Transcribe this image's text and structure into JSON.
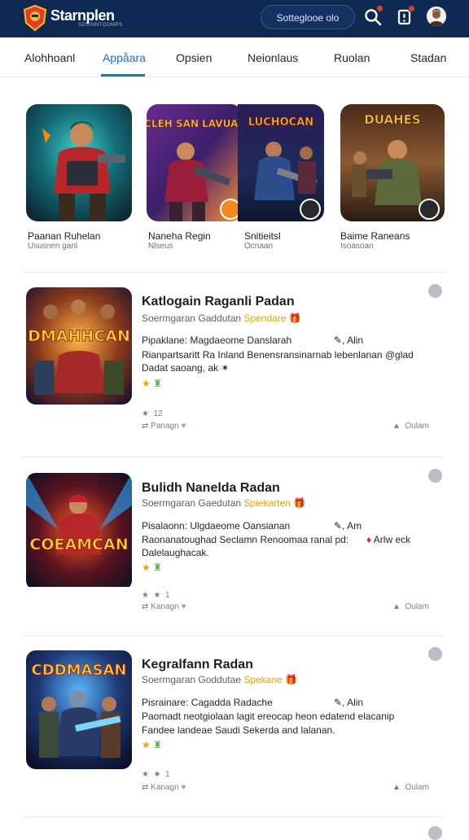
{
  "header": {
    "brand": "Starnplen",
    "brand_sub": "SDSINNTOOMPS",
    "search_label": "Sotteglooe olo",
    "icons": [
      "search-icon",
      "notification-icon",
      "avatar"
    ],
    "colors": {
      "bar": "#0f2a52",
      "accent": "#1a73c7",
      "badge": "#e53935"
    }
  },
  "tabs": [
    {
      "label": "Alohhoanl"
    },
    {
      "label": "Appåara",
      "active": true
    },
    {
      "label": "Opsien"
    },
    {
      "label": "Neionlaus"
    },
    {
      "label": "Ruolan"
    },
    {
      "label": "Stadan"
    }
  ],
  "featured": [
    {
      "title": "Paanan Ruhelan",
      "sub": "Ususnen ganl",
      "art": "hero"
    },
    {
      "title": "Naneha Regin",
      "sub": "Nlseus",
      "art_text": "DACLEH SAN LAVUADAS",
      "badge_color": "#f08a1c"
    },
    {
      "title": "Snitieitsl",
      "sub": "Ocnaan",
      "art_text": "LUCHOCAN",
      "badge_color": "#2a2a2a"
    },
    {
      "title": "Baime Raneans",
      "sub": "Isoasoan",
      "art_text": "DUAHES",
      "badge_color": "#2a2a2a"
    }
  ],
  "items": [
    {
      "title": "Katlogain Raganli Padan",
      "sub_prefix": "Soermgaran Gaddutan",
      "sub_highlight": "Spendare",
      "line1": "Pipaklane: Magdaeome Danslarah",
      "line1_right": "Alin",
      "line2": "Rianpartsaritt Ra Inland Benensransinarnab lebenlanan @glad",
      "line3": "Dadat saoang, ak",
      "meta_count": "12",
      "meta_left": "Panagn",
      "meta_right": "Oulam",
      "art_text": "DMAHHCAN"
    },
    {
      "title": "Bulidh Nanelda Radan",
      "sub_prefix": "Soermgaran Gaedutan",
      "sub_highlight": "Spiekarten",
      "line1": "Pisalaonn: Ulgdaeome Oansianan",
      "line1_right": "Am",
      "line2": "Raonanatoughad Seclamn Renoomaa ranal pd:",
      "line2_right": "Arlw eck",
      "line3": "Dalelaughacak.",
      "meta_count": "1",
      "meta_left": "Kanagn",
      "meta_right": "Oulam",
      "art_text": "COEAMCAN"
    },
    {
      "title": "Kegralfann Radan",
      "sub_prefix": "Soermgaran Goddutae",
      "sub_highlight": "Spekane",
      "line1": "Pisrainare: Cagadda Radache",
      "line1_right": "Alin",
      "line2": "Paomadt neotgiolaan lagit ereocap heon edatend elacanip",
      "line3": "Fandee landeae Saudi Sekerda and lalanan.",
      "meta_count": "1",
      "meta_left": "Kanagn",
      "meta_right": "Oulam",
      "art_text": "CDDMASAN"
    }
  ]
}
